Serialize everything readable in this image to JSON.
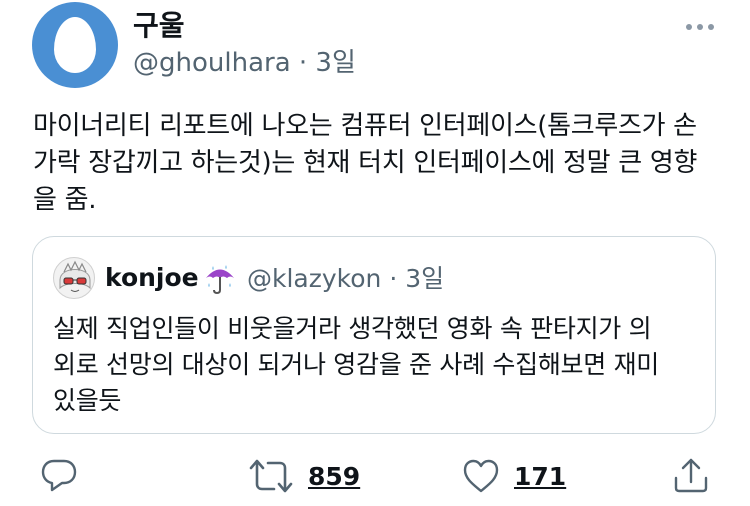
{
  "author": {
    "display_name": "구울",
    "handle": "@ghoulhara",
    "separator": " · ",
    "time": "3일"
  },
  "tweet": {
    "text": "마이너리티 리포트에 나오는 컴퓨터 인터페이스(톰크루즈가 손\n가락 장갑끼고 하는것)는 현재 터치 인터페이스에 정말 큰 영향\n을 줌."
  },
  "quoted_tweet": {
    "display_name": "konjoe",
    "emoji": "umbrella-with-rain-drops",
    "handle": "@klazykon",
    "separator": " · ",
    "time": "3일",
    "text": "실제 직업인들이 비웃을거라 생각했던 영화 속 판타지가 의\n외로 선망의 대상이 되거나 영감을 준 사례 수집해보면 재미\n있을듯"
  },
  "actions": {
    "reply": {
      "icon": "reply-icon",
      "count": ""
    },
    "retweet": {
      "icon": "retweet-icon",
      "count": "859"
    },
    "like": {
      "icon": "heart-icon",
      "count": "171"
    },
    "share": {
      "icon": "share-icon"
    }
  },
  "colors": {
    "text": "#0f1419",
    "secondary": "#536471",
    "icon": "#536471",
    "border": "#cfd9de",
    "avatar_bg": "#4a8fd3"
  }
}
